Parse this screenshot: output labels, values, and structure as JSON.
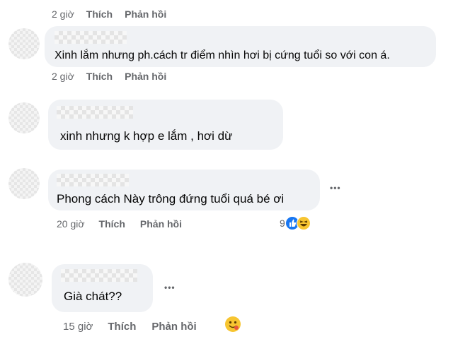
{
  "comments": [
    {
      "text": "",
      "time": "2 giờ",
      "like": "Thích",
      "reply": "Phản hồi"
    },
    {
      "text": "Xinh lắm nhưng ph.cách tr điểm nhìn hơi bị cứng tuổi so với con á.",
      "time": "2 giờ",
      "like": "Thích",
      "reply": "Phản hồi"
    },
    {
      "text": "xinh nhưng k hợp e lắm , hơi dừ",
      "time": "",
      "like": "",
      "reply": ""
    },
    {
      "text": "Phong cách Này trông đứng tuổi quá bé ơi",
      "time": "20 giờ",
      "like": "Thích",
      "reply": "Phản hồi",
      "more": "•••",
      "reaction_count": "9"
    },
    {
      "text": "Già chát??",
      "time": "15 giờ",
      "like": "Thích",
      "reply": "Phản hồi",
      "more": "•••"
    }
  ],
  "colors": {
    "bubble": "#f0f2f5",
    "meta": "#65676b",
    "like": "#1877f2",
    "haha": "#f7c531"
  },
  "icons": [
    "like-reaction-icon",
    "haha-reaction-icon",
    "more-options-icon"
  ]
}
